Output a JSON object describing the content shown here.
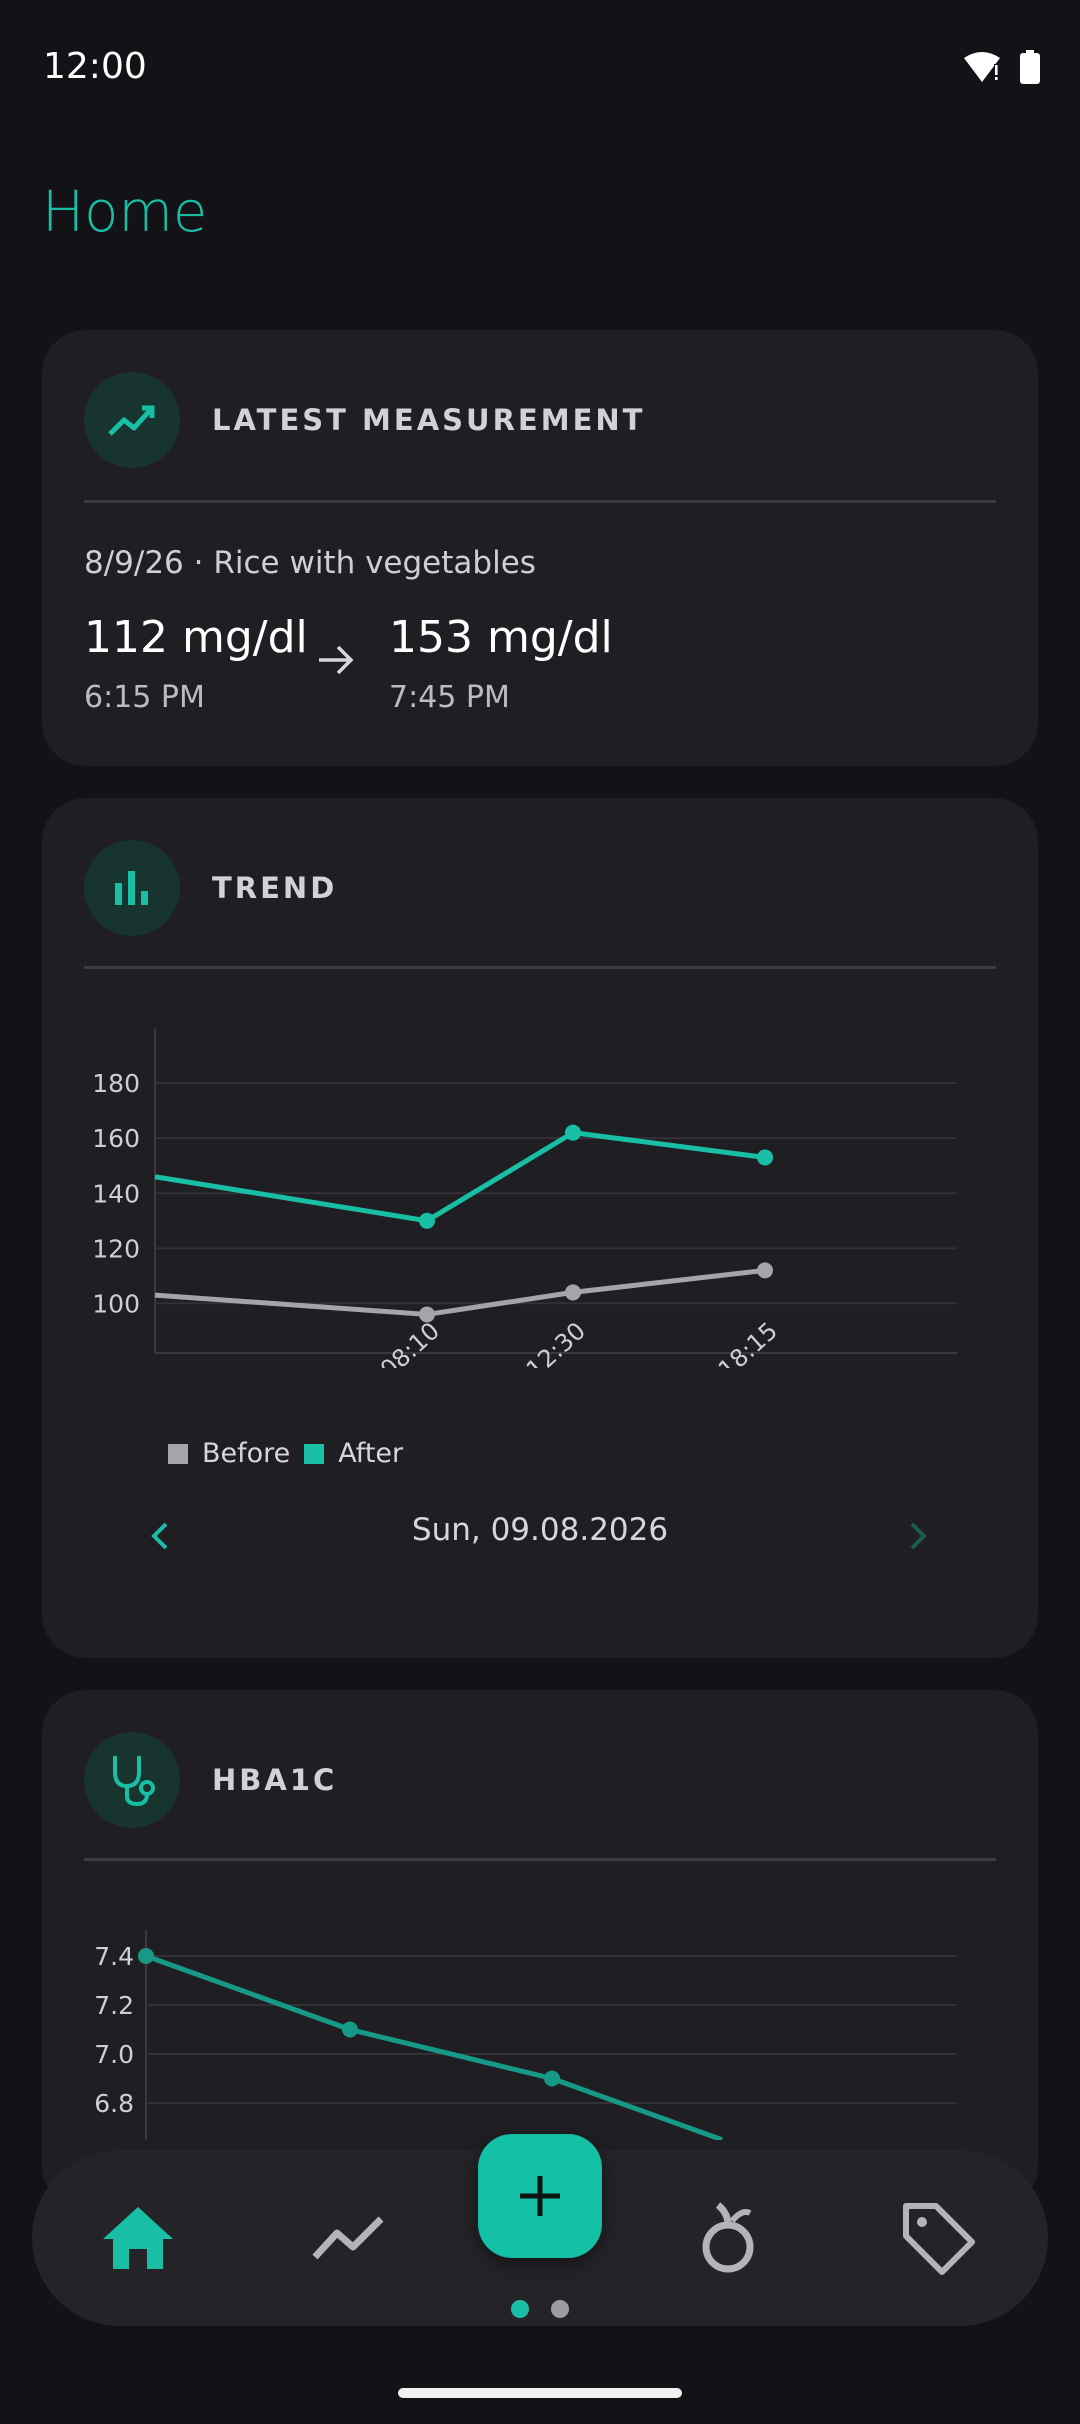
{
  "status_bar": {
    "time": "12:00",
    "icons": [
      "wifi-alert-icon",
      "battery-icon"
    ]
  },
  "page": {
    "title": "Home"
  },
  "colors": {
    "accent": "#19bfa5",
    "before_series": "#a6a4aa",
    "background": "#131217",
    "card": "#1f1e23"
  },
  "latest_measurement": {
    "title": "LATEST MEASUREMENT",
    "icon": "trending-up-icon",
    "meal": "8/9/26 · Rice with vegetables",
    "before_value": "112 mg/dl",
    "before_time": "6:15 PM",
    "after_value": "153 mg/dl",
    "after_time": "7:45 PM"
  },
  "trend": {
    "title": "TREND",
    "icon": "bar-chart-icon",
    "date": "Sun, 09.08.2026",
    "legend_before": "Before",
    "legend_after": "After"
  },
  "hba1c": {
    "title": "HBA1C",
    "icon": "stethoscope-icon"
  },
  "nav": {
    "items": [
      "home-icon",
      "trending-up-icon",
      "apple-icon",
      "tag-icon"
    ],
    "fab_icon": "plus-icon",
    "page_indicator": {
      "count": 2,
      "active": 0
    }
  },
  "chart_data": [
    {
      "type": "line",
      "title": "",
      "x": [
        "08:10",
        "12:30",
        "18:15"
      ],
      "ylim": [
        82,
        200
      ],
      "yticks": [
        100,
        120,
        140,
        160,
        180
      ],
      "grid": true,
      "legend": "bottom-left",
      "series": [
        {
          "name": "Before",
          "points": [
            [
              null,
              103
            ],
            [
              "08:10",
              96
            ],
            [
              "12:30",
              104
            ],
            [
              "18:15",
              112
            ]
          ]
        },
        {
          "name": "After",
          "points": [
            [
              null,
              146
            ],
            [
              "08:10",
              130
            ],
            [
              "12:30",
              162
            ],
            [
              "18:15",
              153
            ]
          ]
        }
      ]
    },
    {
      "type": "line",
      "title": "",
      "ylim": [
        6.6,
        7.5
      ],
      "yticks": [
        6.8,
        7.0,
        7.2,
        7.4
      ],
      "grid": true,
      "series": [
        {
          "values": [
            7.4,
            7.1,
            6.9,
            6.65
          ]
        }
      ]
    }
  ]
}
